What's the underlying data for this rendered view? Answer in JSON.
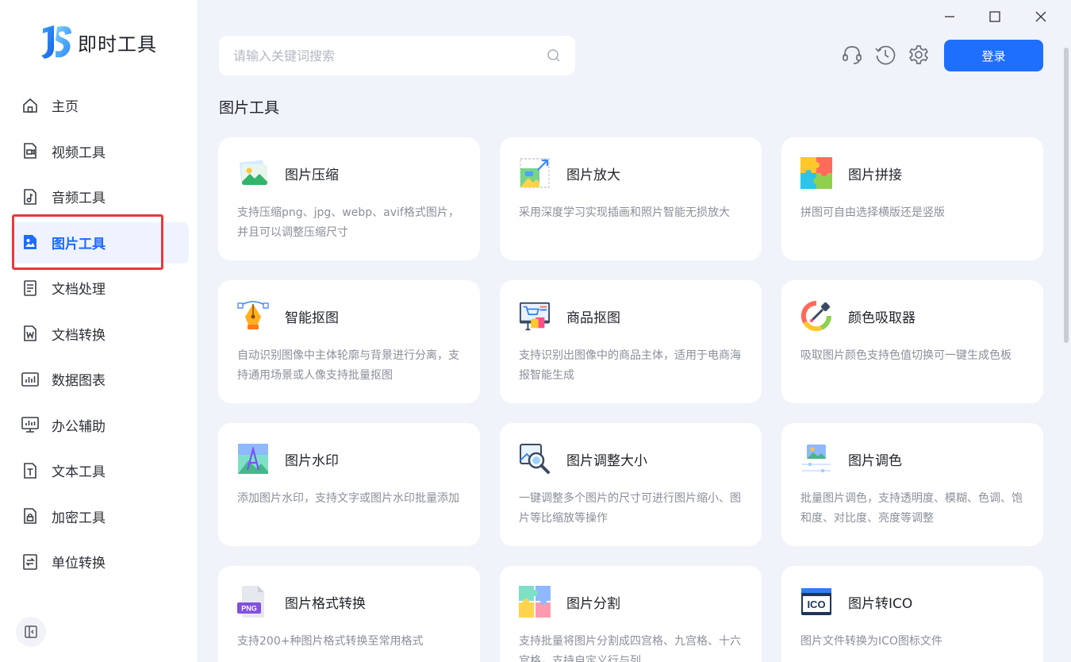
{
  "app": {
    "name": "即时工具"
  },
  "sidebar": {
    "items": [
      {
        "label": "主页",
        "icon": "home-icon"
      },
      {
        "label": "视频工具",
        "icon": "video-icon"
      },
      {
        "label": "音频工具",
        "icon": "audio-icon"
      },
      {
        "label": "图片工具",
        "icon": "image-icon",
        "active": true
      },
      {
        "label": "文档处理",
        "icon": "document-icon"
      },
      {
        "label": "文档转换",
        "icon": "word-doc-icon"
      },
      {
        "label": "数据图表",
        "icon": "chart-icon"
      },
      {
        "label": "办公辅助",
        "icon": "monitor-icon"
      },
      {
        "label": "文本工具",
        "icon": "text-icon"
      },
      {
        "label": "加密工具",
        "icon": "lock-file-icon"
      },
      {
        "label": "单位转换",
        "icon": "convert-icon"
      }
    ]
  },
  "search": {
    "placeholder": "请输入关键词搜索"
  },
  "header": {
    "login_label": "登录"
  },
  "section": {
    "title": "图片工具"
  },
  "colors": {
    "accent": "#1f6fff",
    "highlight": "#e8383d"
  },
  "cards": [
    {
      "title": "图片压缩",
      "desc": "支持压缩png、jpg、webp、avif格式图片，并且可以调整压缩尺寸",
      "icon": "landscape-image-icon"
    },
    {
      "title": "图片放大",
      "desc": "采用深度学习实现插画和照片智能无损放大",
      "icon": "enlarge-image-icon"
    },
    {
      "title": "图片拼接",
      "desc": "拼图可自由选择横版还是竖版",
      "icon": "puzzle-icon"
    },
    {
      "title": "智能抠图",
      "desc": "自动识别图像中主体轮廓与背景进行分离，支持通用场景或人像支持批量抠图",
      "icon": "pen-tool-icon"
    },
    {
      "title": "商品抠图",
      "desc": "支持识别出图像中的商品主体，适用于电商海报智能生成",
      "icon": "shopping-cart-icon"
    },
    {
      "title": "颜色吸取器",
      "desc": "吸取图片颜色支持色值切换可一键生成色板",
      "icon": "color-picker-icon"
    },
    {
      "title": "图片水印",
      "desc": "添加图片水印，支持文字或图片水印批量添加",
      "icon": "watermark-icon"
    },
    {
      "title": "图片调整大小",
      "desc": "一键调整多个图片的尺寸可进行图片缩小、图片等比缩放等操作",
      "icon": "resize-magnifier-icon"
    },
    {
      "title": "图片调色",
      "desc": "批量图片调色，支持透明度、模糊、色调、饱和度、对比度、亮度等调整",
      "icon": "adjust-sliders-icon"
    },
    {
      "title": "图片格式转换",
      "desc": "支持200+种图片格式转换至常用格式",
      "icon": "png-file-icon"
    },
    {
      "title": "图片分割",
      "desc": "支持批量将图片分割成四宫格、九宫格、十六宫格，支持自定义行与列",
      "icon": "split-puzzle-icon"
    },
    {
      "title": "图片转ICO",
      "desc": "图片文件转换为ICO图标文件",
      "icon": "ico-icon",
      "badge": "ICO"
    }
  ],
  "png_badge": "PNG"
}
